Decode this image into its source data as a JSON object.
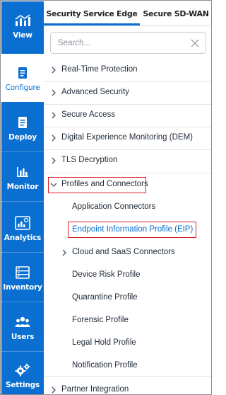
{
  "rail": {
    "items": [
      {
        "label": "View",
        "icon": "view-chart-icon"
      },
      {
        "label": "Configure",
        "icon": "configure-document-icon",
        "active": true
      },
      {
        "label": "Deploy",
        "icon": "deploy-document-icon"
      },
      {
        "label": "Monitor",
        "icon": "monitor-bar-chart-icon"
      },
      {
        "label": "Analytics",
        "icon": "analytics-report-icon"
      },
      {
        "label": "Inventory",
        "icon": "inventory-server-icon"
      },
      {
        "label": "Users",
        "icon": "users-group-icon"
      },
      {
        "label": "Settings",
        "icon": "settings-gears-icon"
      }
    ]
  },
  "tabs": {
    "items": [
      {
        "label": "Security Service Edge",
        "active": true
      },
      {
        "label": "Secure SD-WAN",
        "active": false
      }
    ]
  },
  "search": {
    "placeholder": "Search..."
  },
  "menu": {
    "items": [
      {
        "label": "Real-Time Protection",
        "chevron": "right"
      },
      {
        "label": "Advanced Security",
        "chevron": "right"
      },
      {
        "label": "Secure Access",
        "chevron": "right"
      },
      {
        "label": "Digital Experience Monitoring (DEM)",
        "chevron": "right"
      },
      {
        "label": "TLS Decryption",
        "chevron": "right"
      },
      {
        "label": "Profiles and Connectors",
        "chevron": "down",
        "highlighted": true
      },
      {
        "label": "Application Connectors",
        "chevron": "none",
        "indent": 1
      },
      {
        "label": "Endpoint Information Profile (EIP)",
        "chevron": "none",
        "indent": 1,
        "highlighted": true,
        "selected": true
      },
      {
        "label": "Cloud and SaaS Connectors",
        "chevron": "right",
        "indent": 1
      },
      {
        "label": "Device Risk Profile",
        "chevron": "none",
        "indent": 1
      },
      {
        "label": "Quarantine Profile",
        "chevron": "none",
        "indent": 1
      },
      {
        "label": "Forensic Profile",
        "chevron": "none",
        "indent": 1
      },
      {
        "label": "Legal Hold Profile",
        "chevron": "none",
        "indent": 1
      },
      {
        "label": "Notification Profile",
        "chevron": "none",
        "indent": 1
      },
      {
        "label": "Partner Integration",
        "chevron": "right"
      }
    ]
  },
  "colors": {
    "accent": "#0a6fd0",
    "highlight": "#d91e2a"
  }
}
